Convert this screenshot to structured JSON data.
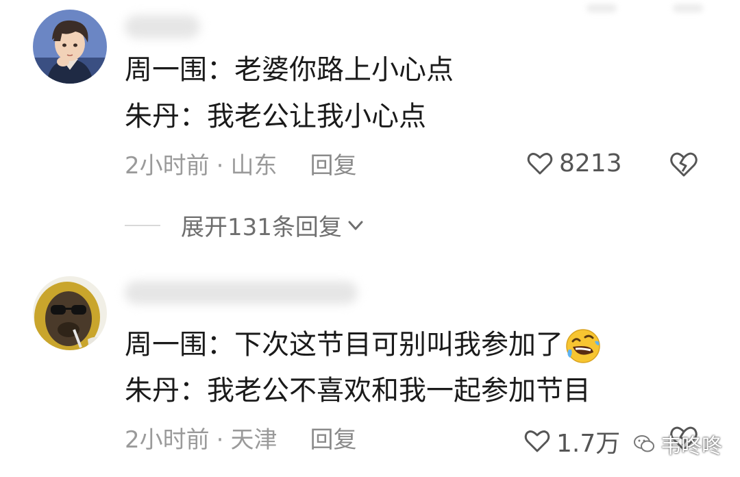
{
  "comments": [
    {
      "lines": [
        "周一围：老婆你路上小心点",
        "朱丹：我老公让我小心点"
      ],
      "time": "2小时前",
      "separator": "·",
      "location": "山东",
      "reply": "回复",
      "likes": "8213"
    },
    {
      "lines": [
        "周一围：下次这节目可别叫我参加了",
        "朱丹：我老公不喜欢和我一起参加节目"
      ],
      "time": "2小时前",
      "separator": "·",
      "location": "天津",
      "reply": "回复",
      "likes": "1.7万"
    }
  ],
  "expand_replies": "展开131条回复",
  "watermark": "韦咚咚",
  "icons": {
    "like": "heart-outline-icon",
    "dislike": "broken-heart-icon",
    "expand": "chevron-down-icon",
    "emoji": "rolling-laughing-emoji",
    "watermark": "wechat-icon"
  }
}
